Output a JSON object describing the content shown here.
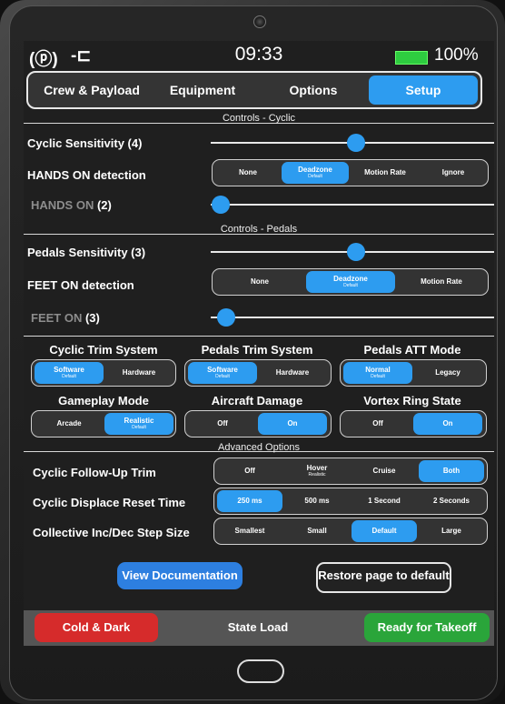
{
  "status": {
    "time": "09:33",
    "battery": "100%",
    "icon_left": "(ⓟ)",
    "plug_icon": "-⊏"
  },
  "tabs": [
    {
      "label": "Crew & Payload",
      "active": false
    },
    {
      "label": "Equipment",
      "active": false
    },
    {
      "label": "Options",
      "active": false
    },
    {
      "label": "Setup",
      "active": true
    }
  ],
  "cyclic": {
    "section_title": "Controls - Cyclic",
    "sensitivity_label": "Cyclic Sensitivity (4)",
    "sensitivity_value": 4,
    "hands_on_detection_label": "HANDS ON detection",
    "hands_on_options": [
      {
        "label": "None",
        "sub": ""
      },
      {
        "label": "Deadzone",
        "sub": "Default"
      },
      {
        "label": "Motion Rate",
        "sub": ""
      },
      {
        "label": "Ignore",
        "sub": ""
      }
    ],
    "hands_on_selected": "Deadzone",
    "hands_on_label": "HANDS ON",
    "hands_on_value": "(2)"
  },
  "pedals": {
    "section_title": "Controls - Pedals",
    "sensitivity_label": "Pedals Sensitivity (3)",
    "sensitivity_value": 3,
    "feet_on_detection_label": "FEET ON detection",
    "feet_on_options": [
      {
        "label": "None",
        "sub": ""
      },
      {
        "label": "Deadzone",
        "sub": "Default"
      },
      {
        "label": "Motion Rate",
        "sub": ""
      }
    ],
    "feet_on_selected": "Deadzone",
    "feet_on_label": "FEET ON",
    "feet_on_value": "(3)"
  },
  "grid": {
    "cyclic_trim": {
      "title": "Cyclic Trim System",
      "options": [
        {
          "label": "Software",
          "sub": "Default"
        },
        {
          "label": "Hardware",
          "sub": ""
        }
      ],
      "selected": "Software"
    },
    "pedals_trim": {
      "title": "Pedals Trim System",
      "options": [
        {
          "label": "Software",
          "sub": "Default"
        },
        {
          "label": "Hardware",
          "sub": ""
        }
      ],
      "selected": "Software"
    },
    "pedals_att": {
      "title": "Pedals ATT Mode",
      "options": [
        {
          "label": "Normal",
          "sub": "Default"
        },
        {
          "label": "Legacy",
          "sub": ""
        }
      ],
      "selected": "Normal"
    },
    "gameplay": {
      "title": "Gameplay Mode",
      "options": [
        {
          "label": "Arcade",
          "sub": ""
        },
        {
          "label": "Realistic",
          "sub": "Default"
        }
      ],
      "selected": "Realistic"
    },
    "damage": {
      "title": "Aircraft Damage",
      "options": [
        {
          "label": "Off",
          "sub": ""
        },
        {
          "label": "On",
          "sub": ""
        }
      ],
      "selected": "On"
    },
    "vortex": {
      "title": "Vortex Ring State",
      "options": [
        {
          "label": "Off",
          "sub": ""
        },
        {
          "label": "On",
          "sub": ""
        }
      ],
      "selected": "On"
    }
  },
  "advanced": {
    "section_title": "Advanced Options",
    "follow_up": {
      "label": "Cyclic Follow-Up Trim",
      "options": [
        {
          "label": "Off",
          "sub": ""
        },
        {
          "label": "Hover",
          "sub": "Realistic"
        },
        {
          "label": "Cruise",
          "sub": ""
        },
        {
          "label": "Both",
          "sub": ""
        }
      ],
      "selected": "Both"
    },
    "displace": {
      "label": "Cyclic Displace Reset Time",
      "options": [
        {
          "label": "250 ms",
          "sub": ""
        },
        {
          "label": "500 ms",
          "sub": ""
        },
        {
          "label": "1 Second",
          "sub": ""
        },
        {
          "label": "2 Seconds",
          "sub": ""
        }
      ],
      "selected": "250 ms"
    },
    "step": {
      "label": "Collective Inc/Dec Step Size",
      "options": [
        {
          "label": "Smallest",
          "sub": ""
        },
        {
          "label": "Small",
          "sub": ""
        },
        {
          "label": "Default",
          "sub": ""
        },
        {
          "label": "Large",
          "sub": ""
        }
      ],
      "selected": "Default"
    }
  },
  "buttons": {
    "view_doc": "View Documentation",
    "restore": "Restore page to default"
  },
  "bottom": {
    "cold_dark": "Cold & Dark",
    "state_load": "State Load",
    "ready": "Ready for Takeoff"
  },
  "colors": {
    "accent": "#2d9cf0",
    "cold_dark": "#d62b2b",
    "ready": "#2aa53a"
  }
}
